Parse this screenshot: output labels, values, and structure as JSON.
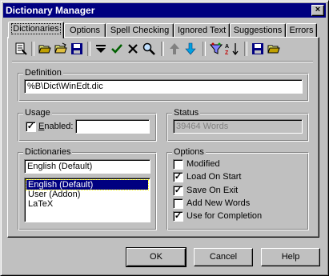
{
  "window": {
    "title": "Dictionary Manager",
    "close_glyph": "×"
  },
  "tabs": [
    {
      "label": "Dictionaries",
      "active": true
    },
    {
      "label": "Options"
    },
    {
      "label": "Spell Checking"
    },
    {
      "label": "Ignored Text"
    },
    {
      "label": "Suggestions"
    },
    {
      "label": "Errors"
    }
  ],
  "toolbar": {
    "icons": [
      "select-dictionary-icon",
      "open-folder-icon",
      "open-folder-alt-icon",
      "save-disk-icon",
      "dropdown-triangle-icon",
      "checkmark-icon",
      "delete-x-icon",
      "search-magnifier-icon",
      "arrow-up-icon",
      "arrow-down-icon",
      "filter-funnel-icon",
      "sort-az-icon",
      "save-disk-2-icon",
      "open-folder-2-icon"
    ]
  },
  "definition": {
    "label": "Definition",
    "value": "%B\\Dict\\WinEdt.dic"
  },
  "usage": {
    "label": "Usage",
    "enabled_label": "Enabled:",
    "enabled_checked": true,
    "enabled_value": ""
  },
  "status": {
    "label": "Status",
    "value": "39464 Words"
  },
  "dictionaries": {
    "label": "Dictionaries",
    "current": "English (Default)",
    "items": [
      "English (Default)",
      "User (Addon)",
      "LaTeX"
    ],
    "selected_index": 0
  },
  "options": {
    "label": "Options",
    "items": [
      {
        "label": "Modified",
        "checked": false
      },
      {
        "label": "Load On Start",
        "checked": true
      },
      {
        "label": "Save On Exit",
        "checked": true
      },
      {
        "label": "Add New Words",
        "checked": false
      },
      {
        "label": "Use for Completion",
        "checked": true
      }
    ]
  },
  "buttons": {
    "ok": "OK",
    "cancel": "Cancel",
    "help": "Help"
  },
  "check_glyph": "✓"
}
